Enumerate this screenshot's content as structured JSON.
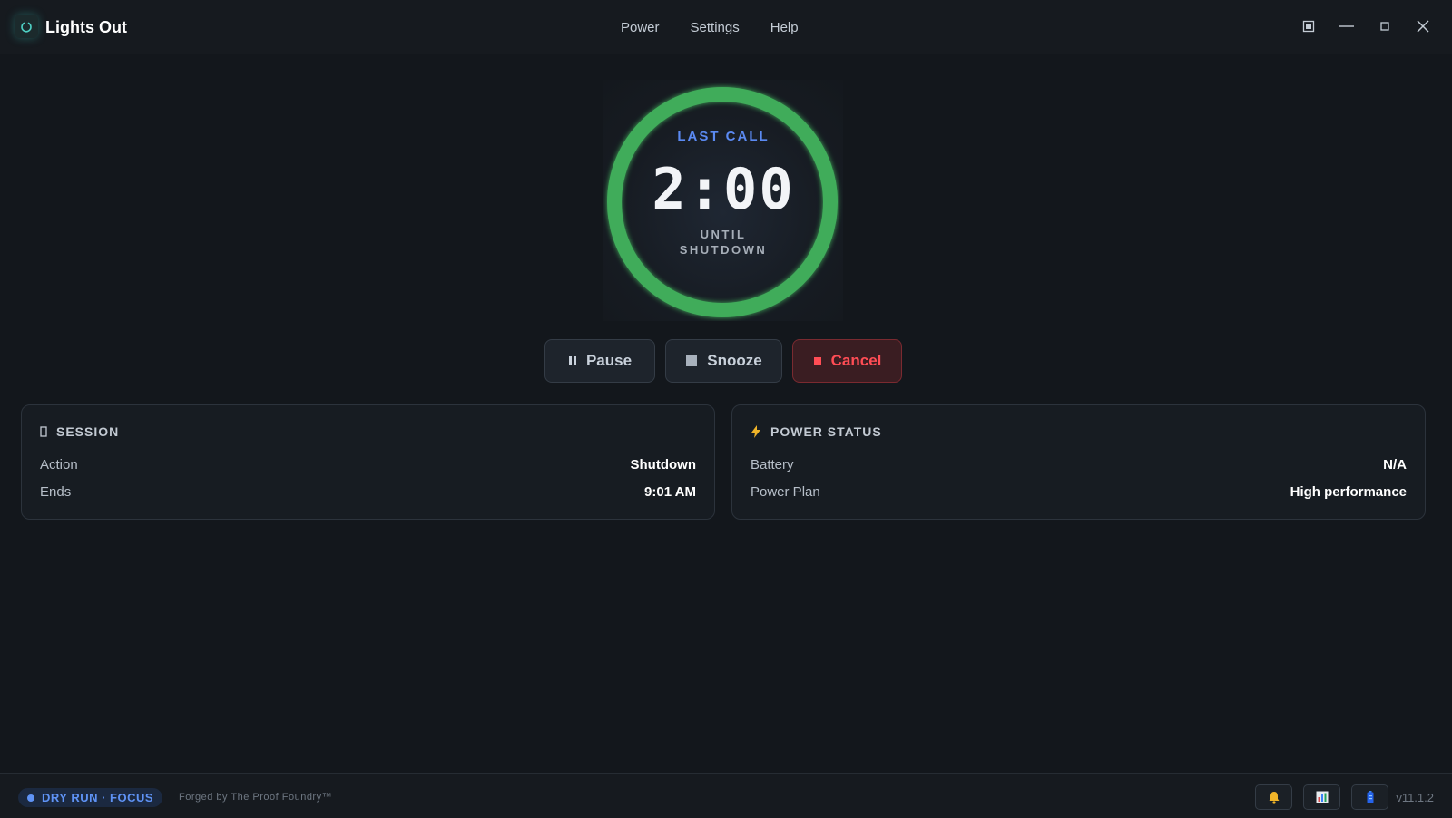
{
  "app": {
    "title": "Lights Out"
  },
  "menu": [
    {
      "label": "Power"
    },
    {
      "label": "Settings"
    },
    {
      "label": "Help"
    }
  ],
  "timer": {
    "top_label": "LAST CALL",
    "time": "2:00",
    "bottom_label_line1": "UNTIL",
    "bottom_label_line2": "SHUTDOWN",
    "progress": 1.0,
    "ring_color": "#3fac5a"
  },
  "actions": {
    "pause_label": "Pause",
    "snooze_label": "Snooze",
    "cancel_label": "Cancel"
  },
  "session": {
    "heading": "SESSION",
    "rows": [
      {
        "key": "Action",
        "value": "Shutdown"
      },
      {
        "key": "Ends",
        "value": "9:01 AM"
      }
    ]
  },
  "power": {
    "heading": "POWER STATUS",
    "rows": [
      {
        "key": "Battery",
        "value": "N/A"
      },
      {
        "key": "Power Plan",
        "value": "High performance"
      }
    ]
  },
  "statusbar": {
    "mode": "DRY RUN · FOCUS",
    "credit": "Forged by The Proof Foundry™",
    "version": "v11.1.2"
  },
  "colors": {
    "accent": "#5b8af2",
    "ring": "#3fac5a",
    "danger": "#ff4d55",
    "bolt": "#f0b429"
  },
  "icons": {
    "logo": "power-logo-icon",
    "pause": "pause-icon",
    "snooze": "square-icon",
    "cancel": "stop-icon",
    "session": "rectangle-icon",
    "power": "lightning-bolt-icon",
    "notify": "bell-icon",
    "stats": "bar-chart-icon",
    "battery": "battery-icon"
  }
}
